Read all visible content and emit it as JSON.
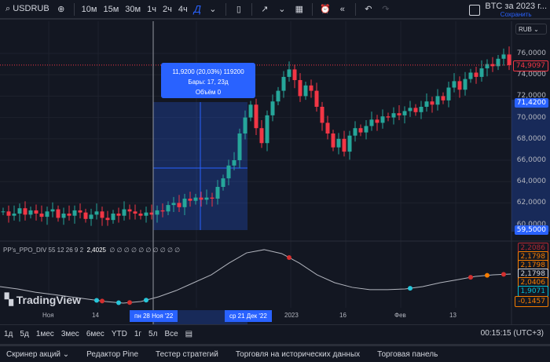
{
  "toolbar": {
    "symbol": "USDRUB",
    "intervals": [
      "10м",
      "15м",
      "30м",
      "1ч",
      "2ч",
      "4ч"
    ],
    "active_interval": "Д",
    "layout_title": "BTC за 2023 г...",
    "layout_save": "Сохранить"
  },
  "currency": "RUB",
  "colors": {
    "up": "#26a69a",
    "down": "#f23645",
    "accent": "#2962ff",
    "bg": "#131722"
  },
  "tooltip": {
    "line1": "11,9200 (20,03%) 119200",
    "line2": "Бары: 17, 23д",
    "line3": "Объём 0"
  },
  "price_labels": [
    "76,0000",
    "74,0000",
    "72,0000",
    "70,0000",
    "68,0000",
    "66,0000",
    "64,0000",
    "62,0000",
    "60,0000"
  ],
  "price_badges": {
    "last": "74,9097",
    "top": "71,4200",
    "bottom": "59,5000"
  },
  "indicator": {
    "name": "PP's_PPO_DIV 55 12 26 9 2",
    "value": "2,4025",
    "zeros": "∅ ∅ ∅ ∅ ∅ ∅ ∅ ∅ ∅ ∅",
    "badges": [
      {
        "v": "2,2086",
        "c": "#b22833"
      },
      {
        "v": "2,1798",
        "c": "#f57c00"
      },
      {
        "v": "2,1798",
        "c": "#f57c00"
      },
      {
        "v": "2,1798",
        "c": "#d1d4dc"
      },
      {
        "v": "2,0406",
        "c": "#f57c00"
      },
      {
        "v": "1,9071",
        "c": "#00bcd4"
      },
      {
        "v": "-0,1457",
        "c": "#f57c00"
      }
    ]
  },
  "time_axis": {
    "labels": [
      {
        "t": "Ноя",
        "x": 62
      },
      {
        "t": "14",
        "x": 125
      },
      {
        "t": "2023",
        "x": 370
      },
      {
        "t": "16",
        "x": 440
      },
      {
        "t": "Фев",
        "x": 510
      },
      {
        "t": "13",
        "x": 580
      }
    ],
    "start_badge": "пн 28 Ноя '22",
    "end_badge": "ср 21 Дек '22"
  },
  "logo": "TradingView",
  "ranges": [
    "1д",
    "5д",
    "1мес",
    "3мес",
    "6мес",
    "YTD",
    "1г",
    "5л",
    "Все"
  ],
  "clock": "00:15:15 (UTC+3)",
  "bottom_tabs": [
    "Скринер акций ⌄",
    "Редактор Pine",
    "Тестер стратегий",
    "Торговля на исторических данных",
    "Торговая панель"
  ],
  "chart_data": {
    "type": "candlestick",
    "ylim": [
      59,
      77
    ],
    "closes": [
      61.2,
      60.8,
      61.0,
      61.5,
      60.9,
      61.3,
      61.0,
      60.7,
      61.2,
      61.4,
      60.6,
      61.0,
      60.8,
      61.3,
      61.1,
      60.5,
      60.9,
      61.2,
      60.6,
      60.4,
      61.0,
      60.8,
      61.4,
      61.2,
      61.0,
      60.8,
      61.1,
      60.9,
      61.3,
      61.2,
      61.8,
      62.0,
      61.6,
      62.4,
      62.2,
      62.5,
      62.3,
      62.5,
      62.4,
      63.5,
      64.3,
      65.5,
      66.0,
      68.5,
      70.0,
      71.2,
      69.0,
      67.6,
      70.2,
      71.5,
      72.5,
      73.8,
      74.5,
      73.5,
      72.0,
      73.0,
      72.5,
      71.0,
      69.5,
      68.5,
      67.2,
      68.0,
      66.8,
      68.3,
      69.0,
      68.6,
      69.2,
      69.8,
      69.5,
      70.1,
      70.0,
      70.4,
      70.2,
      70.6,
      70.9,
      70.5,
      71.0,
      71.5,
      71.2,
      72.0,
      71.6,
      72.8,
      73.4,
      72.6,
      73.6,
      74.2,
      73.8,
      74.6,
      75.0,
      74.8,
      75.5,
      75.9,
      74.9
    ],
    "indicator_series": [
      1.929,
      1.913,
      1.891,
      1.875,
      1.859,
      1.843,
      1.827,
      1.816,
      1.827,
      1.859,
      1.902,
      1.956,
      2.01,
      2.09,
      2.16,
      2.182,
      2.155,
      2.09,
      2.01,
      1.956,
      1.924,
      1.908,
      1.908,
      1.913,
      1.929,
      1.956,
      1.977,
      1.999,
      2.01,
      2.015
    ],
    "indicator_dots": [
      {
        "bar": 17,
        "c": "#26c6da"
      },
      {
        "bar": 18,
        "c": "#d32f2f"
      },
      {
        "bar": 21,
        "c": "#26c6da"
      },
      {
        "bar": 23,
        "c": "#d32f2f"
      },
      {
        "bar": 26,
        "c": "#26c6da"
      },
      {
        "bar": 52,
        "c": "#d32f2f"
      },
      {
        "bar": 74,
        "c": "#26c6da"
      },
      {
        "bar": 85,
        "c": "#d32f2f"
      },
      {
        "bar": 88,
        "c": "#f57c00"
      },
      {
        "bar": 91,
        "c": "#d32f2f"
      }
    ]
  }
}
